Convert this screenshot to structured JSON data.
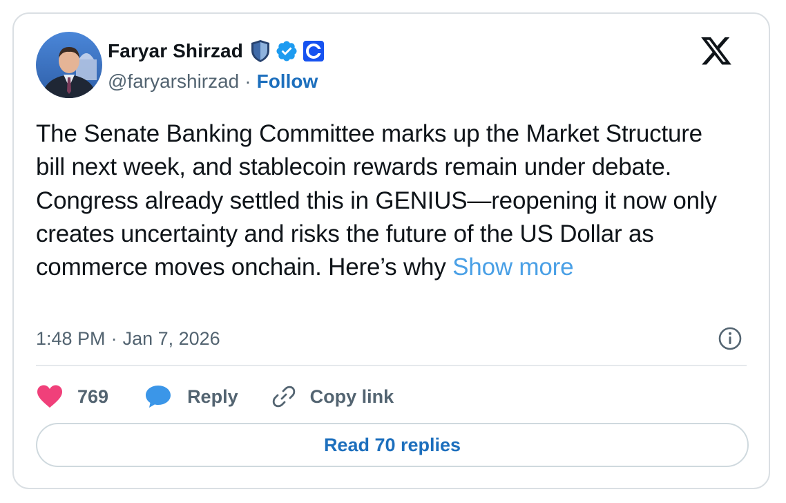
{
  "author": {
    "display_name": "Faryar Shirzad",
    "handle": "@faryarshirzad",
    "separator": "·",
    "follow_label": "Follow"
  },
  "icons": {
    "avatar": "profile-photo",
    "badge_1": "shield-badge-icon",
    "badge_2": "verified-badge-icon",
    "badge_3": "coinbase-logo-icon",
    "brand": "x-logo-icon",
    "info": "info-icon",
    "like": "heart-icon",
    "reply": "speech-bubble-icon",
    "copy": "link-icon"
  },
  "tweet": {
    "text": "The Senate Banking Committee marks up the Market Structure bill next week, and stablecoin rewards remain under debate. Congress already settled this in GENIUS—reopening it now only creates uncertainty and risks the future of the US Dollar as commerce moves onchain. Here’s why ",
    "show_more_label": "Show more"
  },
  "meta": {
    "time": "1:48 PM",
    "separator": "·",
    "date": "Jan 7, 2026"
  },
  "actions": {
    "like_count": "769",
    "reply_label": "Reply",
    "copy_label": "Copy link"
  },
  "read_replies_label": "Read 70 replies",
  "colors": {
    "link_blue": "#1d6fbd",
    "show_more_blue": "#4aa0e6",
    "heart_pink": "#f0407a",
    "reply_blue": "#3b96e8",
    "muted_text": "#536471",
    "border": "#dadfe3"
  }
}
